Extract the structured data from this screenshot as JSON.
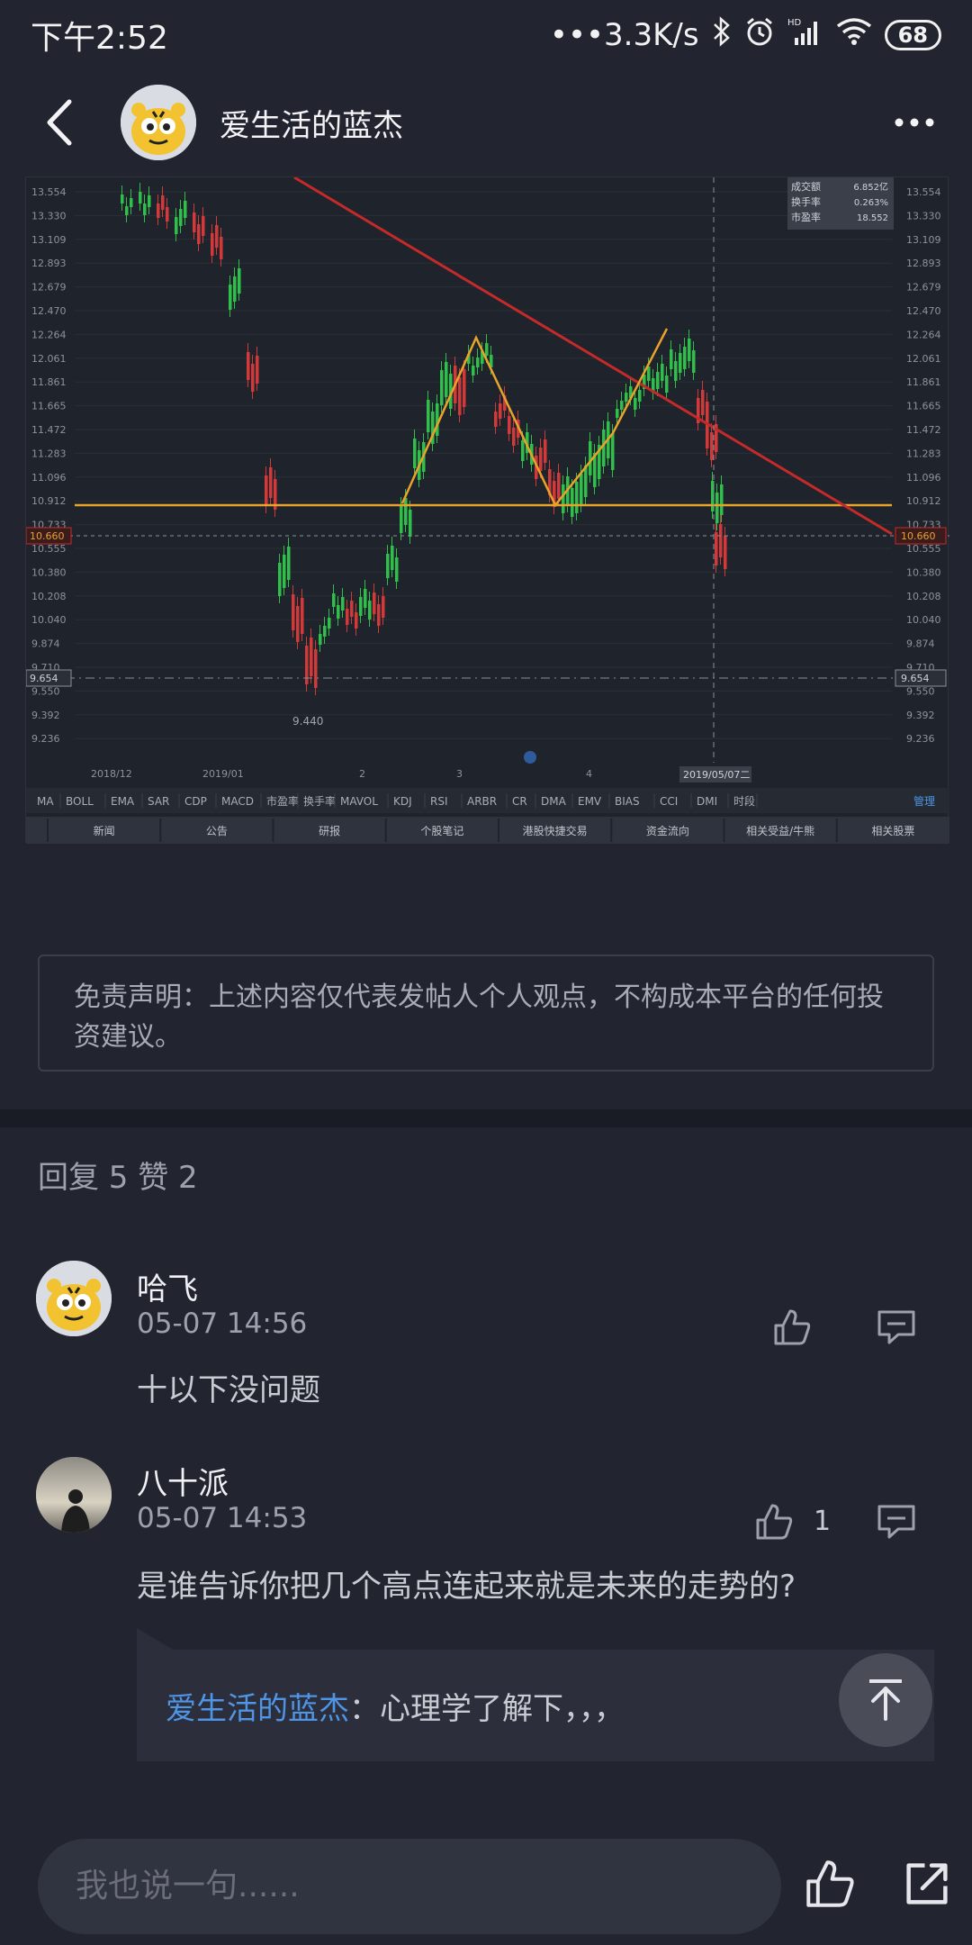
{
  "status_bar": {
    "time": "下午2:52",
    "network_speed": "•••3.3K/s",
    "battery": "68",
    "icons": [
      "bluetooth-icon",
      "alarm-icon",
      "hd-signal-icon",
      "wifi-icon",
      "battery-icon"
    ]
  },
  "header": {
    "title": "爱生活的蓝杰",
    "back_icon": "chevron-left-icon",
    "more_icon": "more-dots-icon"
  },
  "chart": {
    "ticker_info": [
      "成交额",
      "换手率",
      "市盈率"
    ],
    "ticker_values": [
      "6.852亿",
      "0.263%",
      "18.552"
    ],
    "y_ticks": [
      "13.554",
      "13.330",
      "13.109",
      "12.893",
      "12.679",
      "12.470",
      "12.264",
      "12.061",
      "11.861",
      "11.665",
      "11.472",
      "11.283",
      "11.096",
      "10.912",
      "10.733",
      "10.555",
      "10.380",
      "10.208",
      "10.040",
      "9.874",
      "9.710",
      "9.550",
      "9.392",
      "9.236"
    ],
    "current_price": "10.660",
    "crosshair_price": "9.654",
    "low_label": "9.440",
    "x_ticks": [
      "2018/12",
      "2019/01",
      "2",
      "3",
      "4"
    ],
    "x_cursor": "2019/05/07二",
    "indicators": [
      "MA",
      "BOLL",
      "EMA",
      "SAR",
      "CDP",
      "MACD",
      "市盈率",
      "换手率",
      "MAVOL",
      "KDJ",
      "RSI",
      "ARBR",
      "CR",
      "DMA",
      "EMV",
      "BIAS",
      "CCI",
      "DMI",
      "时段"
    ],
    "manage_label": "管理",
    "tabs": [
      "新闻",
      "公告",
      "研报",
      "个股笔记",
      "港股快捷交易",
      "资金流向",
      "相关受益/牛熊",
      "相关股票"
    ]
  },
  "disclaimer": "免责声明：上述内容仅代表发帖人个人观点，不构成本平台的任何投资建议。",
  "stats": {
    "text": "回复 5 赞 2"
  },
  "comments": [
    {
      "name": "哈飞",
      "time": "05-07 14:56",
      "text": "十以下没问题",
      "like_count": ""
    },
    {
      "name": "八十派",
      "time": "05-07 14:53",
      "text": "是谁告诉你把几个高点连起来就是未来的走势的?",
      "like_count": "1"
    }
  ],
  "reply": {
    "author": "爱生活的蓝杰",
    "text": "：心理学了解下，，，"
  },
  "bottom_bar": {
    "placeholder": "我也说一句......"
  },
  "colors": {
    "background": "#222430",
    "accent_blue": "#4f95e6",
    "candle_up": "#2fbf4a",
    "candle_down": "#d23a3a",
    "trend_red": "#c42a2a",
    "trend_orange": "#e8a32a"
  }
}
